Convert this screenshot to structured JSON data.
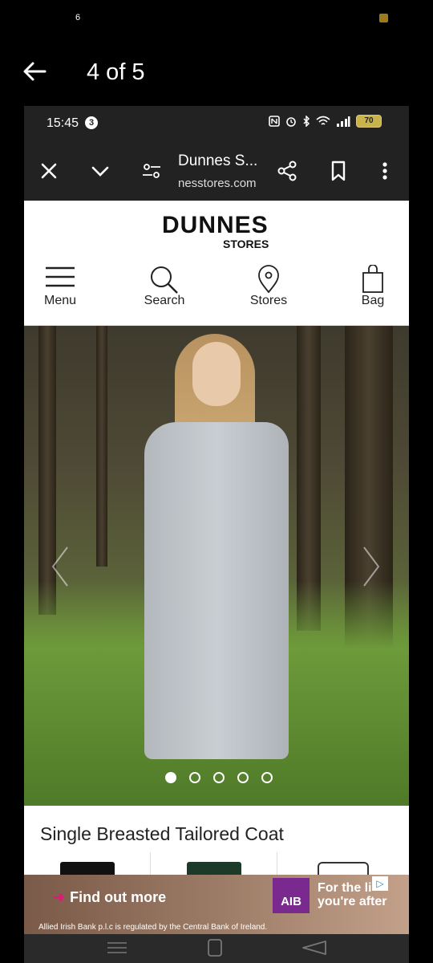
{
  "outer_status": {
    "left_text": "6"
  },
  "viewer": {
    "title": "4 of 5"
  },
  "phone_status": {
    "time": "15:45",
    "notif_count": "3",
    "battery": "70"
  },
  "browser": {
    "page_title": "Dunnes S...",
    "url": "nesstores.com"
  },
  "site": {
    "logo_main": "DUNNES",
    "logo_sub": "STORES",
    "nav": [
      {
        "label": "Menu",
        "icon": "hamburger-icon"
      },
      {
        "label": "Search",
        "icon": "search-icon"
      },
      {
        "label": "Stores",
        "icon": "location-pin-icon"
      },
      {
        "label": "Bag",
        "icon": "bag-icon"
      }
    ]
  },
  "carousel": {
    "dot_count": 5,
    "active_index": 0
  },
  "product": {
    "title": "Single Breasted Tailored Coat"
  },
  "ad": {
    "cta": "Find out more",
    "brand": "AIB",
    "tagline_line1": "For the li",
    "tagline_line2": "you're after",
    "legal": "Allied Irish Bank p.l.c is regulated by the Central Bank of Ireland."
  },
  "colors": {
    "ad_brand": "#7a2a8f",
    "ad_arrow": "#e0197d",
    "battery": "#c8b44a"
  }
}
